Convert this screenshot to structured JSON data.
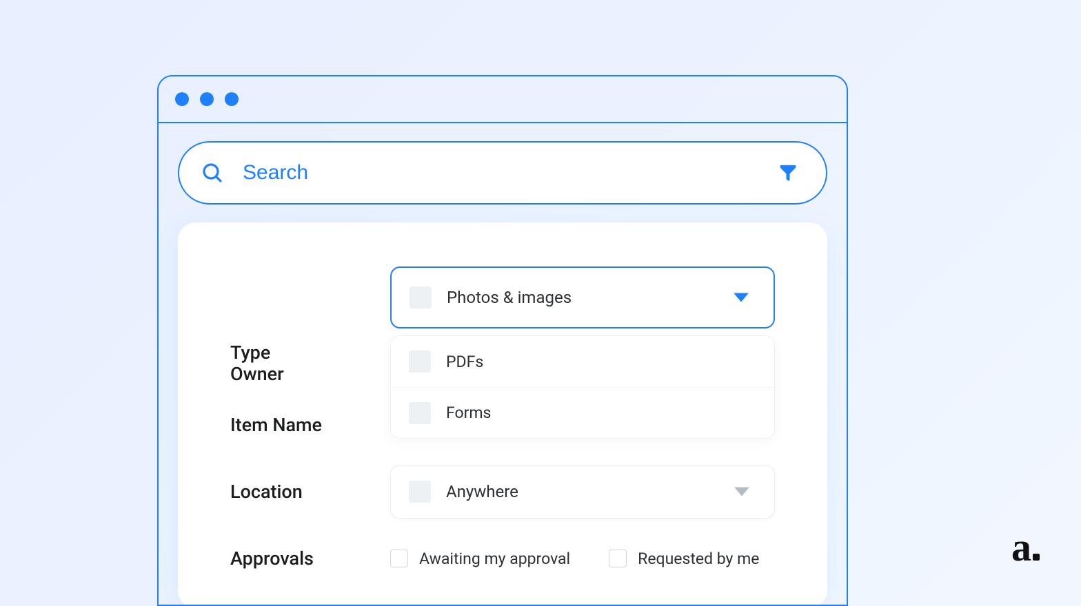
{
  "search": {
    "placeholder": "Search"
  },
  "filters": {
    "type": {
      "label": "Type",
      "selected": "Photos & images",
      "options": [
        "PDFs",
        "Forms"
      ]
    },
    "owner": {
      "label": "Owner"
    },
    "item_name": {
      "label": "Item Name"
    },
    "location": {
      "label": "Location",
      "selected": "Anywhere"
    },
    "approvals": {
      "label": "Approvals",
      "options": [
        "Awaiting my approval",
        "Requested by me"
      ]
    }
  },
  "brand": "a"
}
